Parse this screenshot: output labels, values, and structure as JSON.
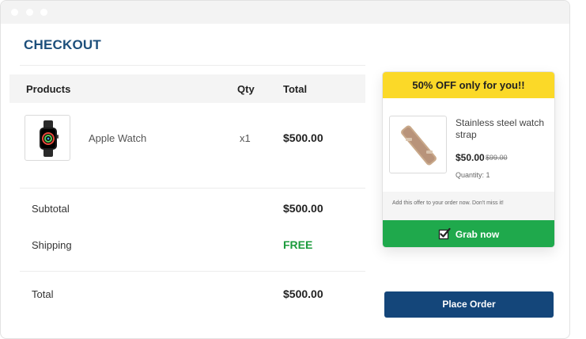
{
  "page": {
    "title": "CHECKOUT"
  },
  "table": {
    "headers": {
      "products": "Products",
      "qty": "Qty",
      "total": "Total"
    },
    "items": [
      {
        "name": "Apple Watch",
        "qty": "x1",
        "total": "$500.00",
        "icon": "apple-watch-icon"
      }
    ]
  },
  "summary": {
    "subtotal_label": "Subtotal",
    "subtotal_value": "$500.00",
    "shipping_label": "Shipping",
    "shipping_value": "FREE",
    "total_label": "Total",
    "total_value": "$500.00"
  },
  "offer": {
    "headline": "50% OFF only for you!!",
    "product_name": "Stainless steel watch strap",
    "price": "$50.00",
    "old_price": "$99.00",
    "quantity": "Quantity: 1",
    "note": "Add this offer to your order now. Don't miss it!",
    "button_label": "Grab now",
    "icon": "watch-strap-icon"
  },
  "actions": {
    "place_order": "Place Order"
  },
  "colors": {
    "title": "#1d4f7b",
    "free": "#1a9b3b",
    "offer_header": "#fbd928",
    "grab_button": "#1fa94c",
    "place_order_button": "#14467a"
  }
}
